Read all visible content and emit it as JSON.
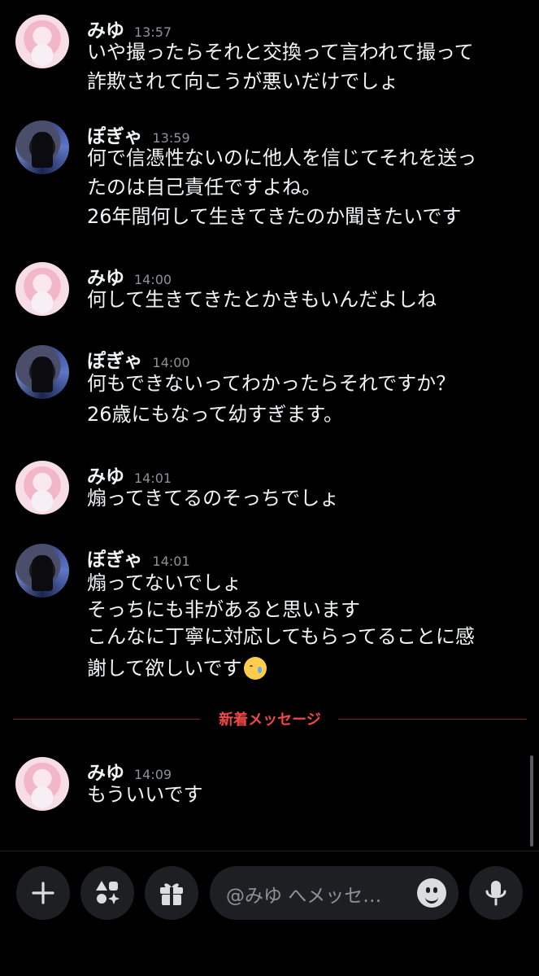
{
  "messages": [
    {
      "user": "みゆ",
      "time": "13:57",
      "avatar": "miyu",
      "lines": [
        "いや撮ったらそれと交換って言われて撮って",
        "詐欺されて向こうが悪いだけでしょ"
      ]
    },
    {
      "user": "ぽぎゃ",
      "time": "13:59",
      "avatar": "pogya",
      "lines": [
        "何で信憑性ないのに他人を信じてそれを送っ",
        "たのは自己責任ですよね。",
        "26年間何して生きてきたのか聞きたいです"
      ]
    },
    {
      "user": "みゆ",
      "time": "14:00",
      "avatar": "miyu",
      "lines": [
        "何して生きてきたとかきもいんだよしね"
      ]
    },
    {
      "user": "ぽぎゃ",
      "time": "14:00",
      "avatar": "pogya",
      "lines": [
        "何もできないってわかったらそれですか？",
        "26歳にもなって幼すぎます。"
      ]
    },
    {
      "user": "みゆ",
      "time": "14:01",
      "avatar": "miyu",
      "lines": [
        "煽ってきてるのそっちでしょ"
      ]
    },
    {
      "user": "ぽぎゃ",
      "time": "14:01",
      "avatar": "pogya",
      "lines": [
        "煽ってないでしょ",
        "そっちにも非があると思います",
        "こんなに丁寧に対応してもらってることに感",
        "謝して欲しいです"
      ],
      "emoji": "crying-face"
    },
    {
      "user": "みゆ",
      "time": "14:09",
      "avatar": "miyu",
      "lines": [
        "もういいです"
      ]
    }
  ],
  "divider": {
    "label": "新着メッセージ"
  },
  "composer": {
    "placeholder": "@みゆ へメッセ…",
    "buttons": [
      "plus-icon",
      "apps-icon",
      "gift-icon"
    ],
    "mic_icon": "microphone-icon",
    "emoji_icon": "smile-icon"
  },
  "colors": {
    "background": "#000000",
    "text": "#f2f3f5",
    "timestamp": "#8e9297",
    "new_divider": "#f04747",
    "button_bg": "#1e1f22"
  }
}
